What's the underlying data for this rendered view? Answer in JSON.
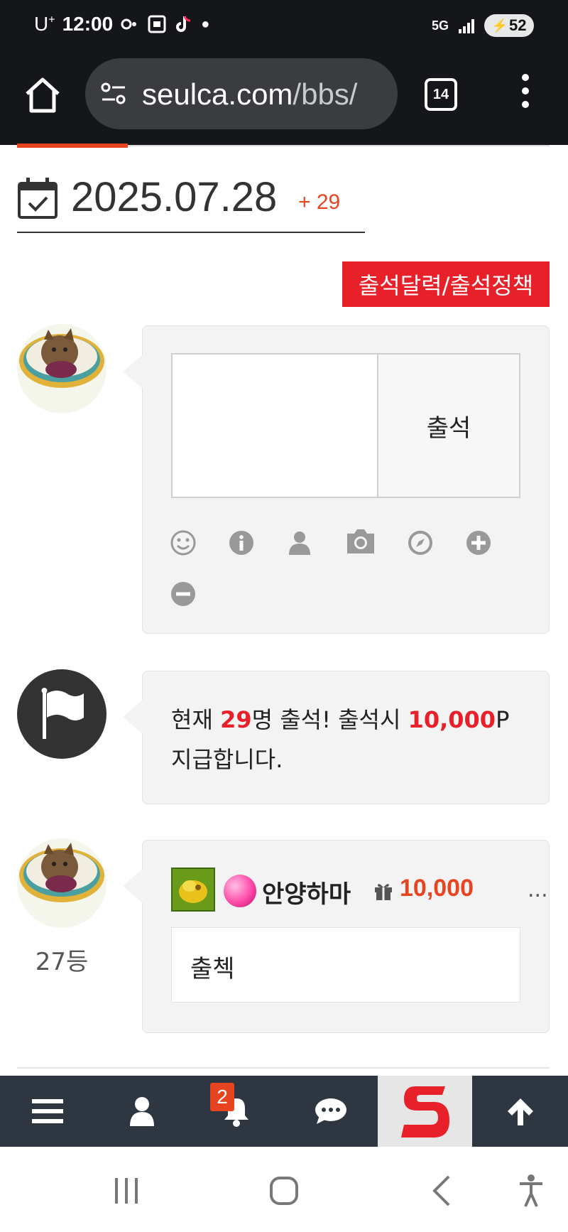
{
  "status_bar": {
    "carrier": "U",
    "carrier_sup": "+",
    "time": "12:00",
    "network": "5G",
    "battery": "52"
  },
  "browser": {
    "url_host": "seulca.com",
    "url_path": "/bbs/",
    "tab_count": "14"
  },
  "attendance": {
    "date": "2025.07.28",
    "today_count": "+ 29",
    "calendar_button": "출석달력/출석정책",
    "submit_button": "출석",
    "textarea_value": "",
    "tools": [
      "smile-icon",
      "info-icon",
      "user-icon",
      "camera-icon",
      "compass-icon",
      "plus-circle-icon",
      "minus-circle-icon"
    ]
  },
  "notice": {
    "prefix": "현재 ",
    "count": "29",
    "middle": "명 출석! 출석시 ",
    "points": "10,000",
    "suffix_p": "P",
    "line2": "지급합니다."
  },
  "entry": {
    "rank": "27등",
    "nickname": "안양하마",
    "points": "10,000",
    "more": "...",
    "comment": "출첵"
  },
  "bottom_nav": {
    "notification_badge": "2",
    "items": [
      "menu-icon",
      "user-icon",
      "bell-icon",
      "chat-icon",
      "site-logo",
      "arrow-up-icon"
    ]
  },
  "colors": {
    "accent_red": "#e8202a",
    "accent_orange": "#e8441f",
    "nav_bg": "#2d3641",
    "browser_bg": "#14161a"
  }
}
